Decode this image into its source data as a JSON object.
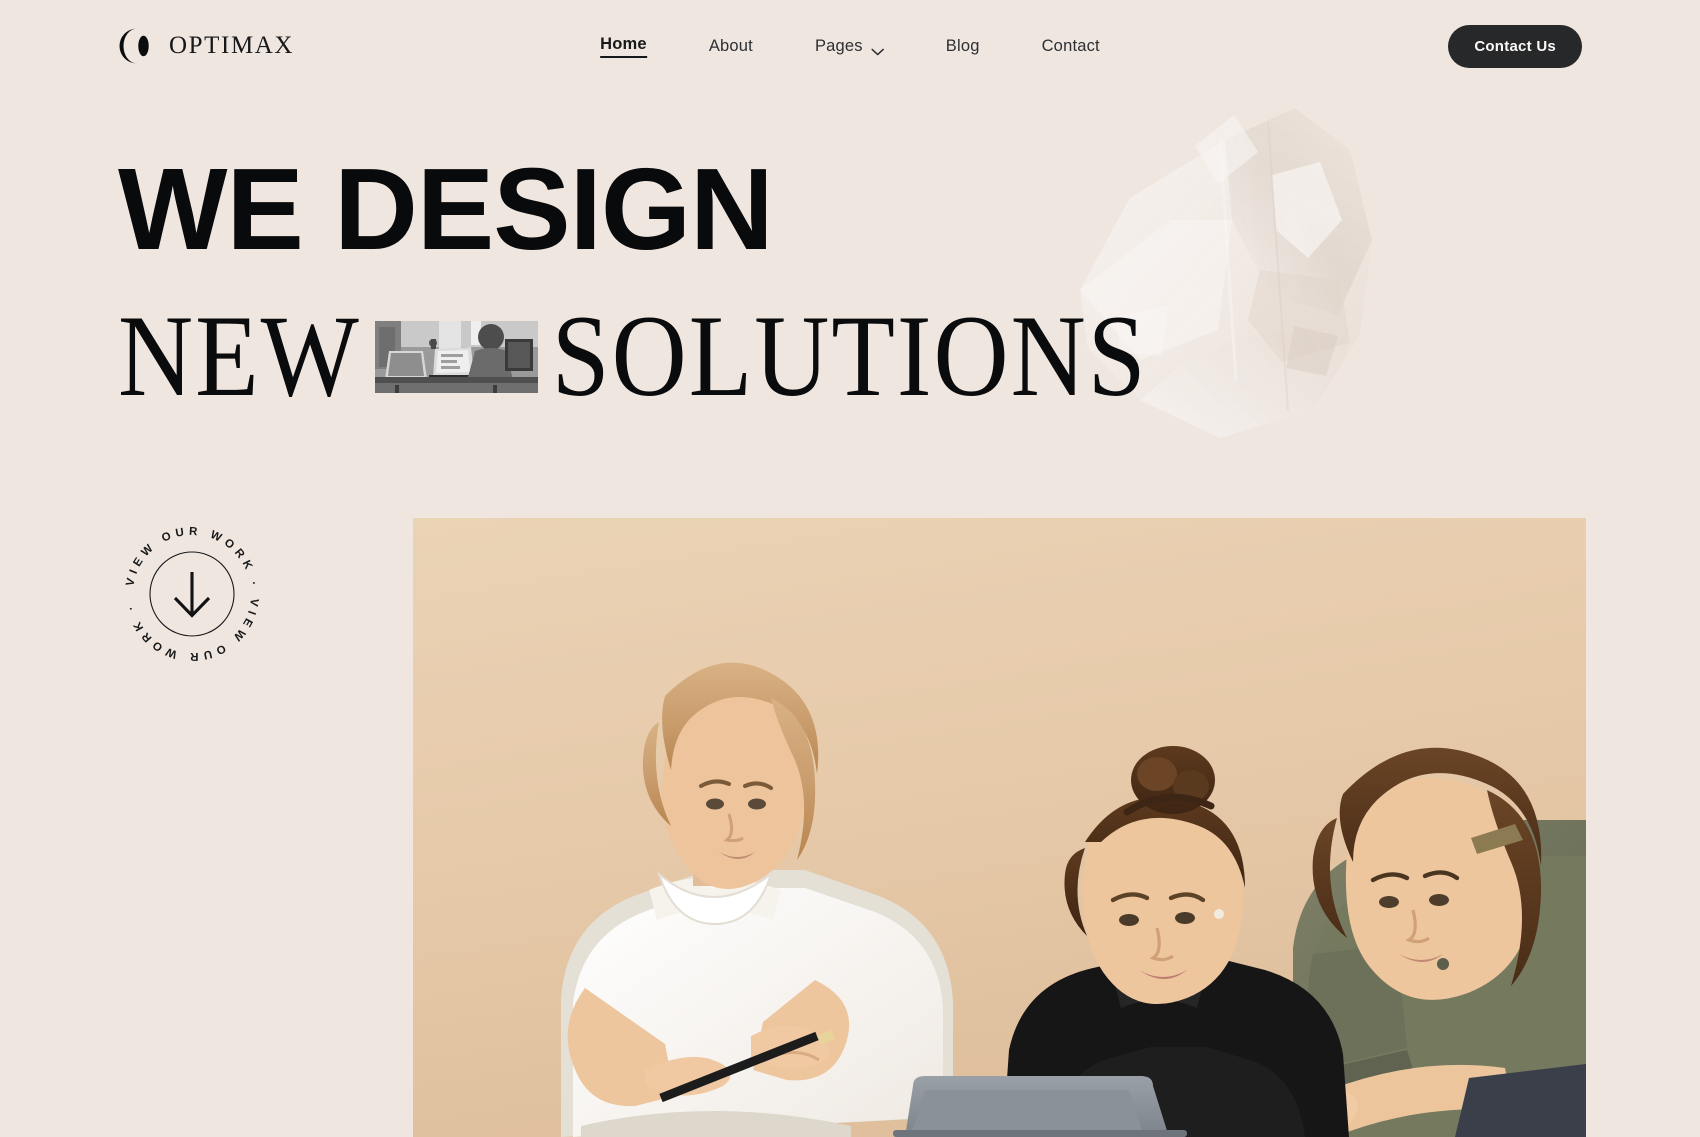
{
  "theme": {
    "background": "#efe6e0",
    "ink": "#16181a",
    "cta_bg": "#26282a",
    "cta_text": "#fbf8f6",
    "photo_bg": "#e6cdae"
  },
  "header": {
    "logo": {
      "mark_icon": "crescent-lens-logo-icon",
      "name": "OPTIMAX"
    },
    "nav": [
      {
        "label": "Home",
        "active": true,
        "icon": null
      },
      {
        "label": "About",
        "active": false,
        "icon": null
      },
      {
        "label": "Pages",
        "active": false,
        "icon": "chevron-down-icon"
      },
      {
        "label": "Blog",
        "active": false,
        "icon": null
      },
      {
        "label": "Contact",
        "active": false,
        "icon": null
      }
    ],
    "cta_label": "Contact Us"
  },
  "hero": {
    "line1": "WE DESIGN",
    "line2_a": "NEW",
    "line2_b": "SOLUTIONS",
    "inline_image_alt": "grayscale office desk with laptops",
    "badge": {
      "text": "VIEW OUR WORK · VIEW OUR WORK ·",
      "icon": "arrow-down-icon"
    },
    "photo_alt": "three colleagues reviewing a laptop with pencils",
    "decoration_alt": "translucent crumpled crystal shape"
  }
}
